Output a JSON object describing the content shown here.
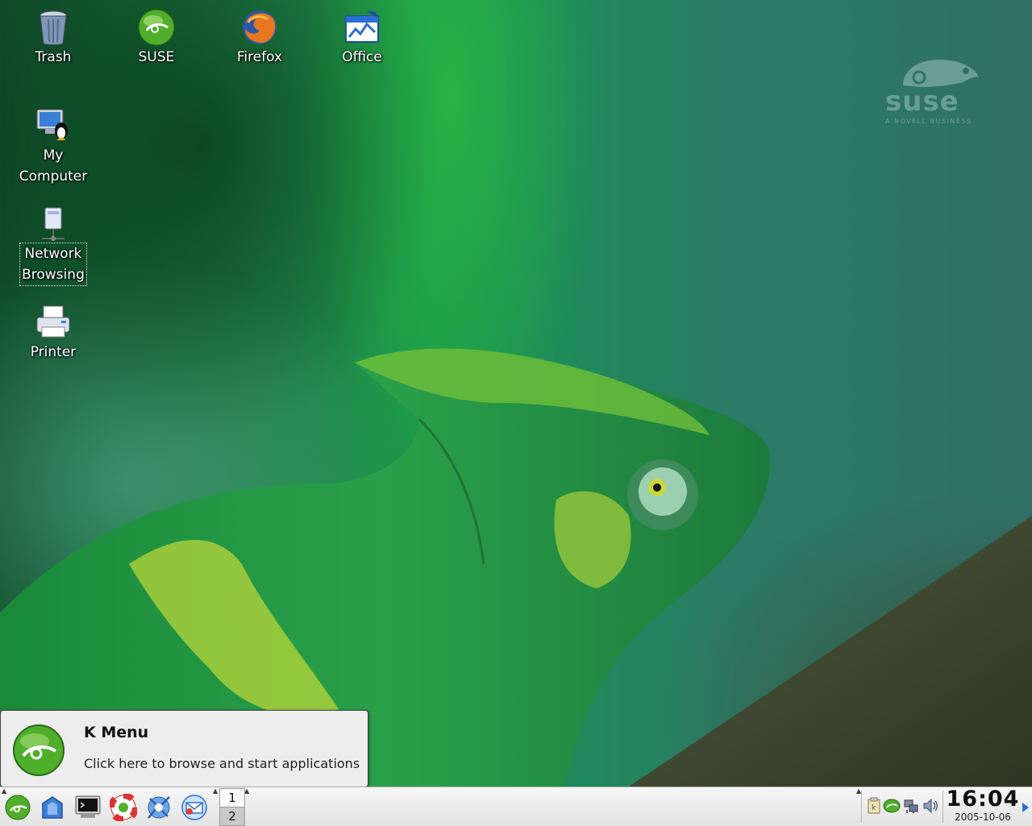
{
  "desktop_icons": [
    {
      "name": "Trash",
      "icon": "trash-icon"
    },
    {
      "name": "SUSE",
      "icon": "suse-icon"
    },
    {
      "name": "Firefox",
      "icon": "firefox-icon"
    },
    {
      "name": "Office",
      "icon": "office-icon"
    },
    {
      "name": "My\nComputer",
      "icon": "my-computer-icon"
    },
    {
      "name": "Network\nBrowsing",
      "icon": "network-browsing-icon"
    },
    {
      "name": "Printer",
      "icon": "printer-icon"
    }
  ],
  "branding": {
    "word": "suse",
    "tagline": "A NOVELL BUSINESS"
  },
  "tooltip": {
    "title": "K Menu",
    "text": "Click here to browse and start applications",
    "icon": "kmenu-icon"
  },
  "taskbar": {
    "launchers": [
      "kmenu-icon",
      "home-folder-icon",
      "terminal-icon",
      "help-lifebuoy-icon",
      "konqueror-icon",
      "mail-icon"
    ],
    "pager": {
      "desktops": [
        "1",
        "2"
      ],
      "active": "1"
    },
    "tray_icons": [
      "klipper-icon",
      "suse-updater-icon",
      "network-icon",
      "volume-icon"
    ],
    "clock": {
      "time": "16:04",
      "date": "2005-10-06"
    }
  },
  "colors": {
    "accent": "#2a6fd3",
    "suse_green": "#5bb030"
  }
}
